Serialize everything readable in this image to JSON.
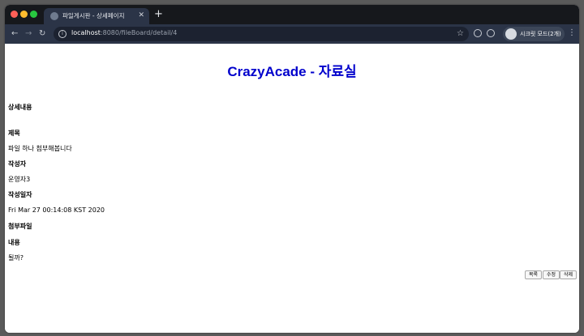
{
  "browser": {
    "tab_title": "파일게시판 - 상세페이지",
    "url_host": "localhost",
    "url_rest": ":8080/fileBoard/detail/4",
    "incognito_label": "시크릿 모드(2개)",
    "icons": {
      "close": "close-icon",
      "new_tab": "plus-icon",
      "back": "arrow-left-icon",
      "forward": "arrow-right-icon",
      "reload": "reload-icon",
      "info": "info-icon",
      "star": "star-icon",
      "menu": "kebab-menu-icon"
    }
  },
  "page": {
    "title": "CrazyAcade - 자료실",
    "section_heading": "상세내용",
    "fields": {
      "subject_label": "제목",
      "subject_value": "파일 하나 첨부해봅니다",
      "author_label": "작성자",
      "author_value": "운영자3",
      "date_label": "작성일자",
      "date_value": "Fri Mar 27 00:14:08 KST 2020",
      "attachment_label": "첨부파일",
      "content_label": "내용",
      "content_value": "될까?"
    },
    "buttons": {
      "list": "목록",
      "edit": "수정",
      "delete": "삭제"
    },
    "title_color": "#0000cc"
  }
}
